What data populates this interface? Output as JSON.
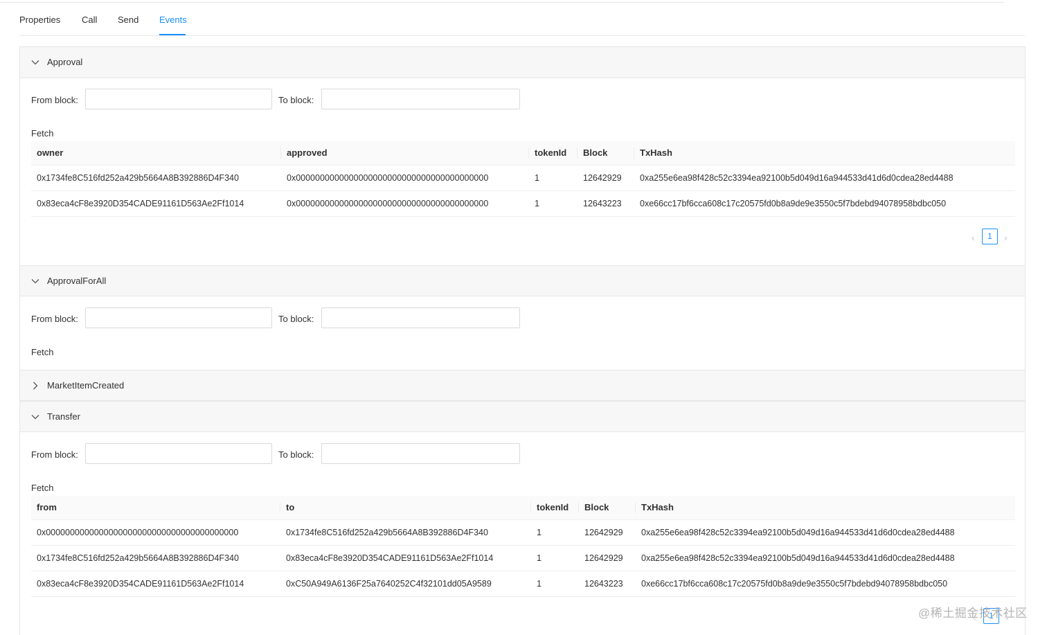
{
  "tabs": [
    {
      "label": "Properties"
    },
    {
      "label": "Call"
    },
    {
      "label": "Send"
    },
    {
      "label": "Events"
    }
  ],
  "form": {
    "from_label": "From block:",
    "to_label": "To block:",
    "fetch_label": "Fetch",
    "from_value": "",
    "to_value": ""
  },
  "panels": {
    "approval": {
      "title": "Approval",
      "expanded": true,
      "columns": [
        "owner",
        "approved",
        "tokenId",
        "Block",
        "TxHash"
      ],
      "rows": [
        [
          "0x1734fe8C516fd252a429b5664A8B392886D4F340",
          "0x0000000000000000000000000000000000000000",
          "1",
          "12642929",
          "0xa255e6ea98f428c52c3394ea92100b5d049d16a944533d41d6d0cdea28ed4488"
        ],
        [
          "0x83eca4cF8e3920D354CADE91161D563Ae2Ff1014",
          "0x0000000000000000000000000000000000000000",
          "1",
          "12643223",
          "0xe66cc17bf6cca608c17c20575fd0b8a9de9e3550c5f7bdebd94078958bdbc050"
        ]
      ],
      "page": "1"
    },
    "approval_for_all": {
      "title": "ApprovalForAll",
      "expanded": true
    },
    "market_item_created": {
      "title": "MarketItemCreated",
      "expanded": false
    },
    "transfer": {
      "title": "Transfer",
      "expanded": true,
      "columns": [
        "from",
        "to",
        "tokenId",
        "Block",
        "TxHash"
      ],
      "rows": [
        [
          "0x0000000000000000000000000000000000000000",
          "0x1734fe8C516fd252a429b5664A8B392886D4F340",
          "1",
          "12642929",
          "0xa255e6ea98f428c52c3394ea92100b5d049d16a944533d41d6d0cdea28ed4488"
        ],
        [
          "0x1734fe8C516fd252a429b5664A8B392886D4F340",
          "0x83eca4cF8e3920D354CADE91161D563Ae2Ff1014",
          "1",
          "12642929",
          "0xa255e6ea98f428c52c3394ea92100b5d049d16a944533d41d6d0cdea28ed4488"
        ],
        [
          "0x83eca4cF8e3920D354CADE91161D563Ae2Ff1014",
          "0xC50A949A6136F25a7640252C4f32101dd05A9589",
          "1",
          "12643223",
          "0xe66cc17bf6cca608c17c20575fd0b8a9de9e3550c5f7bdebd94078958bdbc050"
        ]
      ],
      "page": "1"
    }
  },
  "watermark": "@稀土掘金技术社区",
  "colors": {
    "accent": "#1890ff",
    "panel_header_bg": "#f7f7f7",
    "table_header_bg": "#fafafa",
    "border": "#e6e6e6"
  }
}
